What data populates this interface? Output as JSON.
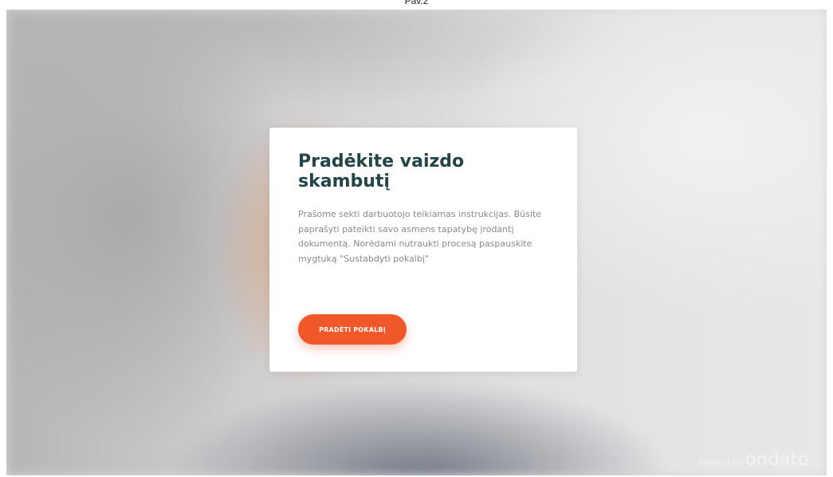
{
  "caption": "Pav.2",
  "dialog": {
    "title": "Pradėkite vaizdo skambutį",
    "body": "Prašome sekti darbuotojo teikiamas instrukcijas. Būsite paprašyti pateikti savo asmens tapatybę įrodantį dokumentą. Norėdami nutraukti procesą paspauskite mygtuką \"Sustabdyti pokalbį\"",
    "button_label": "PRADĖTI POKALBĮ"
  },
  "branding": {
    "prefix": "enabled by",
    "logo": "ondato"
  },
  "colors": {
    "title": "#22454a",
    "accent": "#f0582a",
    "body_text": "#8a8a8a"
  }
}
